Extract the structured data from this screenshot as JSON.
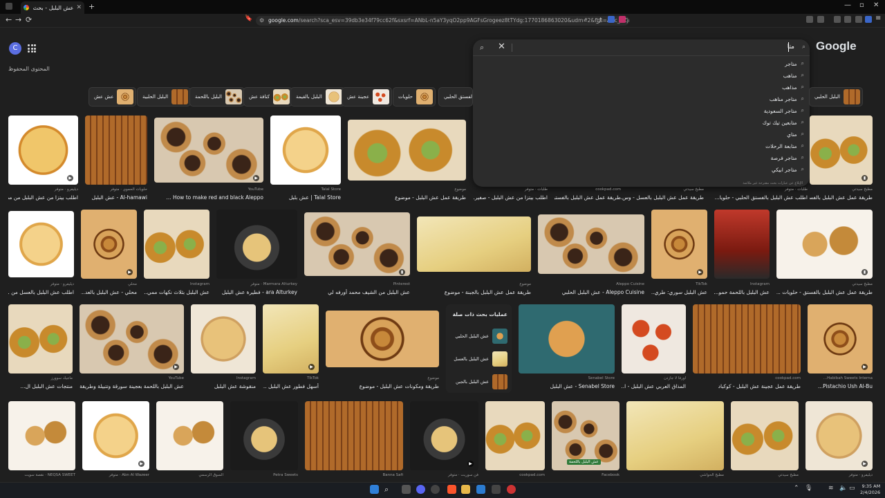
{
  "browser": {
    "tab_title": "عش البلبل - بحث Google",
    "url_host": "google.com",
    "url_rest": "/search?sca_esv=39db3e34f79cc62f&sxsrf=ANbL-n5aY3yqO2pp9AGFsGrogeez8tTYdg:1770186863020&udm=2&fbs=ADc_l-ZjmiS7t...",
    "new_tab": "+"
  },
  "google": {
    "avatar_letter": "C",
    "saved_label": "المحتوى المحفوظ",
    "logo": "Google",
    "search_query": "متا",
    "report_text": "الإبلاغ عن عبارات بحث مقترحة غير ملائمة",
    "suggestions": [
      "متاجر",
      "مناهب",
      "مذاهب",
      "متاجر مناهب",
      "متاجر السعودية",
      "متابعين تيك توك",
      "متاي",
      "متابعة الرحلات",
      "متاجر فرصة",
      "متاجر ابيكي"
    ]
  },
  "chips": [
    "عش عش",
    "البلبل الحلبية",
    "البلبل باللحمة",
    "كنافة عش",
    "البلبل بالقيمة",
    "عجينة عش",
    "حلويات",
    "البلبل بالفستق الحلبي",
    "البلبل الحلبي"
  ],
  "images": [
    {
      "cap": "اطلب بيتزا من عش البلبل من مطع...",
      "src": "ديليفرو · متوفر"
    },
    {
      "cap": "Al-hamawi - عش البلبل",
      "src": "حلويات الحموي · متوفر"
    },
    {
      "cap": "How to make red and black Aleppo ...",
      "src": "YouTube"
    },
    {
      "cap": "Talal Store | عش بلبل",
      "src": "Talal Store"
    },
    {
      "cap": "طريقة عمل عش البلبل - موضوع",
      "src": "موضوع"
    },
    {
      "cap": "اطلب بيتزا من عش البلبل - صفير...",
      "src": "طلبات · متوفر"
    },
    {
      "cap": "طريقة عمل عش البلبل بالفستق...",
      "src": "cookpad.com"
    },
    {
      "cap": "طريقة عمل عش البلبل بالعسل - وس...",
      "src": "مطبخ سيدتي"
    },
    {
      "cap": "اطلب عش البلبل بالفستق الحلبي - حلويا...",
      "src": "طلبات · متوفر"
    },
    {
      "cap": "طريقة عمل عش البلبل بالفستق الحلبي - حلويات...",
      "src": "مطبخ سيدتي"
    },
    {
      "cap": "اطلب عش البلبل بالعسل من ...",
      "src": "ديليفرو · متوفر"
    },
    {
      "cap": "محلي - عش البلبل بالعد...",
      "src": "محلي"
    },
    {
      "cap": "عش البلبل بثلاث نكهات ممي...",
      "src": "Instagram"
    },
    {
      "cap": "ara Alturkey - فطيرة عش البلبل",
      "src": "Marmara Alturkey · متوفر"
    },
    {
      "cap": "عش البلبل من الشيف محمد أورفه لي",
      "src": "Pinterest"
    },
    {
      "cap": "طريقة عمل عش البلبل بالجبنة - موضوع",
      "src": "موضوع"
    },
    {
      "cap": "Aleppo Cuisine - عش البلبل الحلبي",
      "src": "Aleppo Cuisine"
    },
    {
      "cap": "عش البلبل سوري: طري...",
      "src": "TikTok"
    },
    {
      "cap": "عش البلبل باللحمة حمو...",
      "src": "Instagram"
    },
    {
      "cap": "طريقة عمل عش البلبل بالفستق - حلويات ...",
      "src": "مطبخ سيدتي"
    },
    {
      "cap": "منتجات عش البلبل ال...",
      "src": "ماجيك سوورز"
    },
    {
      "cap": "عش البلبل باللحمة بعجينة سورقة وتتبيلة وطريقة ...",
      "src": "YouTube"
    },
    {
      "cap": "منقوشة عش البلبل",
      "src": "Instagram"
    },
    {
      "cap": "أسهل فطور عش البلبل ...",
      "src": "TikTok"
    },
    {
      "cap": "طريقة ومكونات عش البلبل - موضوع",
      "src": "موضوع"
    },
    {
      "cap": "Senabel Store - عش البلبل",
      "src": "Senabel Store"
    },
    {
      "cap": "المذاق العربي عش البلبل - ا...",
      "src": "أورفا لا جازدن"
    },
    {
      "cap": "طريقة عمل عجينة عش البلبل - كوكباد",
      "src": "cookpad.com"
    },
    {
      "cap": "Pistachio Ush Al-Bu...",
      "src": "Habibah Sweets Interna..."
    },
    {
      "cap": "",
      "src": "NEQSA SWEET · نقصة سويت"
    },
    {
      "cap": "",
      "src": "Abn Al Wazeer · متوفر"
    },
    {
      "cap": "",
      "src": "السوق الرسمي"
    },
    {
      "cap": "",
      "src": "Petra Sweets"
    },
    {
      "cap": "",
      "src": "Banna Safi"
    },
    {
      "cap": "",
      "src": "فن سوريت · متوفر"
    },
    {
      "cap": "",
      "src": "cookpad.com"
    },
    {
      "cap": "",
      "src": "Facebook"
    },
    {
      "cap": "",
      "src": "مطبخ الحواشي"
    },
    {
      "cap": "",
      "src": "مطبخ سيدتي"
    },
    {
      "cap": "",
      "src": "ديليفرو · متوفر"
    }
  ],
  "related": {
    "title": "عمليات بحث ذات صلة",
    "items": [
      "عش البلبل الحلبي",
      "عش البلبل بالعسل",
      "عش البلبل بالجبن"
    ]
  },
  "promo_text": "عش البلبل باللحمة",
  "taskbar": {
    "time": "9:35 AM",
    "date": "2/4/2026"
  },
  "colors": {
    "background": "#1f1f1f",
    "accent": "#5b6ee1"
  }
}
